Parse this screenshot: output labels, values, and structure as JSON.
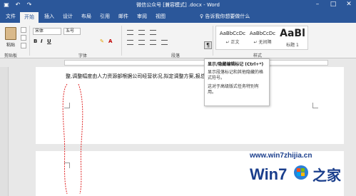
{
  "window": {
    "title": "微信公众号 [兼容模式] .docx - Word",
    "controls": [
      "minimize-icon",
      "restore-icon",
      "close-icon"
    ]
  },
  "quick_access": [
    "save-icon",
    "undo-icon",
    "redo-icon"
  ],
  "tabs": [
    {
      "label": "文件"
    },
    {
      "label": "开始",
      "active": true
    },
    {
      "label": "插入"
    },
    {
      "label": "设计"
    },
    {
      "label": "布局"
    },
    {
      "label": "引用"
    },
    {
      "label": "邮件"
    },
    {
      "label": "审阅"
    },
    {
      "label": "视图"
    }
  ],
  "tell_me": "告诉我你想要做什么",
  "ribbon": {
    "clipboard": {
      "paste": "粘贴",
      "group": "剪贴板"
    },
    "font": {
      "name": "宋体",
      "size": "五号",
      "group": "字体",
      "bold": "B",
      "italic": "I",
      "underline": "U"
    },
    "paragraph": {
      "group": "段落"
    },
    "styles": {
      "group": "样式",
      "cards": [
        {
          "sample": "AaBbCcDc",
          "name": "↵ 正文"
        },
        {
          "sample": "AaBbCcDc",
          "name": "↵ 无间隔"
        },
        {
          "sample": "AaBl",
          "name": "标题 1"
        }
      ]
    }
  },
  "tooltip": {
    "title": "显示/隐藏编辑标记 (Ctrl+*)",
    "line1": "显示段落标记和其他隐藏的格式符号。",
    "line2": "这对于高级版式任务特别有用。"
  },
  "document": {
    "text": "整,调整幅度由人力资源部根据公司经营状况,拟定调整方案,报总经理审批后执行↵"
  },
  "watermark": {
    "url": "www.win7zhijia.cn",
    "logo": "Win7之家"
  },
  "colors": {
    "accent": "#2b579a",
    "ribbon_bg": "#f3f3f3",
    "annotation": "#e02020"
  }
}
